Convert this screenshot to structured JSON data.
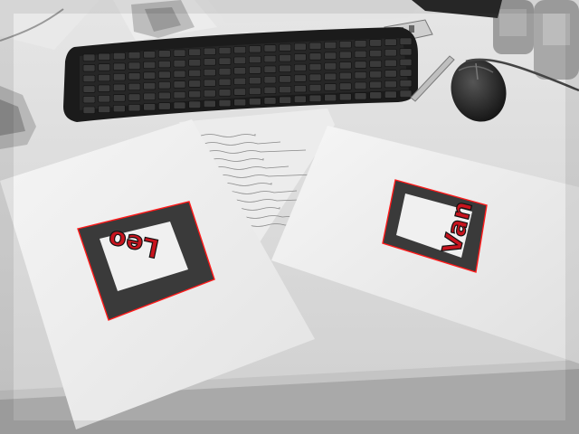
{
  "scene": {
    "colors": {
      "desk": "#d9d9d9",
      "paper": "#f3f3f3",
      "marker": "#3a3a3a",
      "outline": "#ff1a1a",
      "label_fill": "#c8141e",
      "keyboard": "#1c1c1c",
      "mouse": "#222222"
    },
    "markers": [
      {
        "label": "Leo",
        "outline_color": "#ff1a1a"
      },
      {
        "label": "Van",
        "outline_color": "#ff1a1a"
      }
    ],
    "icons": [
      "keyboard-icon",
      "mouse-icon",
      "bottle-icon",
      "paper-sheet-icon"
    ]
  }
}
